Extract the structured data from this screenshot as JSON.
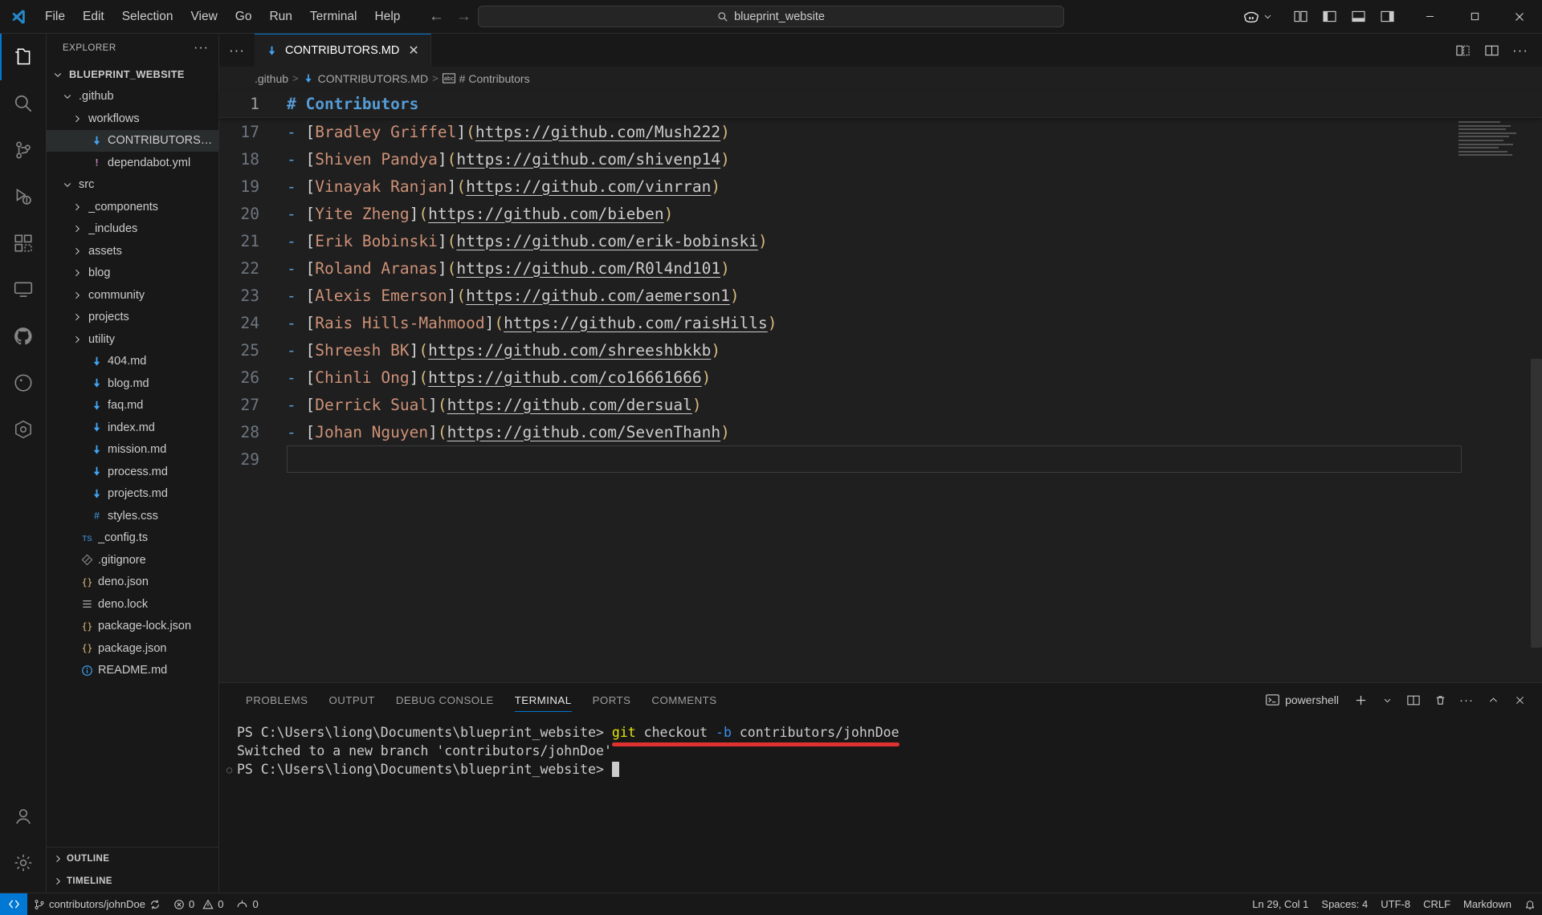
{
  "titlebar": {
    "menus": [
      "File",
      "Edit",
      "Selection",
      "View",
      "Go",
      "Run",
      "Terminal",
      "Help"
    ],
    "back_icon": "arrow-left-icon",
    "forward_icon": "arrow-right-icon",
    "command_center": {
      "value": "blueprint_website",
      "icon": "search-icon"
    },
    "copilot_label": "copilot-icon",
    "layout_icons": [
      "customize-layout-icon",
      "toggle-primary-sidebar-icon",
      "toggle-panel-icon",
      "toggle-secondary-sidebar-icon"
    ],
    "window_controls": {
      "minimize": "─",
      "maximize": "☐",
      "close": "✕"
    }
  },
  "activitybar": {
    "items": [
      {
        "name": "explorer",
        "icon": "files-icon",
        "active": true
      },
      {
        "name": "search",
        "icon": "search-icon",
        "active": false
      },
      {
        "name": "source-control",
        "icon": "source-control-icon",
        "active": false
      },
      {
        "name": "run-and-debug",
        "icon": "debug-icon",
        "active": false
      },
      {
        "name": "extensions",
        "icon": "extensions-icon",
        "active": false
      },
      {
        "name": "remote-explorer",
        "icon": "remote-explorer-icon",
        "active": false
      },
      {
        "name": "github",
        "icon": "github-icon",
        "active": false
      },
      {
        "name": "deno",
        "icon": "deno-icon",
        "active": false
      },
      {
        "name": "kubernetes",
        "icon": "kubernetes-icon",
        "active": false
      }
    ],
    "bottom": [
      {
        "name": "accounts",
        "icon": "account-icon"
      },
      {
        "name": "manage",
        "icon": "gear-icon"
      }
    ]
  },
  "sidebar": {
    "title": "EXPLORER",
    "more_actions": "···",
    "tree": [
      {
        "label": "BLUEPRINT_WEBSITE",
        "indent": 0,
        "twisty": "down",
        "icon": "none",
        "kind": "root",
        "selected": false
      },
      {
        "label": ".github",
        "indent": 1,
        "twisty": "down",
        "icon": "none",
        "kind": "folder",
        "selected": false
      },
      {
        "label": "workflows",
        "indent": 2,
        "twisty": "right",
        "icon": "none",
        "kind": "folder",
        "selected": false
      },
      {
        "label": "CONTRIBUTORS.MD",
        "indent": 2,
        "twisty": "none",
        "icon": "markdown-icon",
        "kind": "file",
        "selected": true
      },
      {
        "label": "dependabot.yml",
        "indent": 2,
        "twisty": "none",
        "icon": "yaml-icon",
        "kind": "file",
        "selected": false
      },
      {
        "label": "src",
        "indent": 1,
        "twisty": "down",
        "icon": "none",
        "kind": "folder",
        "selected": false
      },
      {
        "label": "_components",
        "indent": 2,
        "twisty": "right",
        "icon": "none",
        "kind": "folder",
        "selected": false
      },
      {
        "label": "_includes",
        "indent": 2,
        "twisty": "right",
        "icon": "none",
        "kind": "folder",
        "selected": false
      },
      {
        "label": "assets",
        "indent": 2,
        "twisty": "right",
        "icon": "none",
        "kind": "folder",
        "selected": false
      },
      {
        "label": "blog",
        "indent": 2,
        "twisty": "right",
        "icon": "none",
        "kind": "folder",
        "selected": false
      },
      {
        "label": "community",
        "indent": 2,
        "twisty": "right",
        "icon": "none",
        "kind": "folder",
        "selected": false
      },
      {
        "label": "projects",
        "indent": 2,
        "twisty": "right",
        "icon": "none",
        "kind": "folder",
        "selected": false
      },
      {
        "label": "utility",
        "indent": 2,
        "twisty": "right",
        "icon": "none",
        "kind": "folder",
        "selected": false
      },
      {
        "label": "404.md",
        "indent": 2,
        "twisty": "none",
        "icon": "markdown-icon",
        "kind": "file",
        "selected": false
      },
      {
        "label": "blog.md",
        "indent": 2,
        "twisty": "none",
        "icon": "markdown-icon",
        "kind": "file",
        "selected": false
      },
      {
        "label": "faq.md",
        "indent": 2,
        "twisty": "none",
        "icon": "markdown-icon",
        "kind": "file",
        "selected": false
      },
      {
        "label": "index.md",
        "indent": 2,
        "twisty": "none",
        "icon": "markdown-icon",
        "kind": "file",
        "selected": false
      },
      {
        "label": "mission.md",
        "indent": 2,
        "twisty": "none",
        "icon": "markdown-icon",
        "kind": "file",
        "selected": false
      },
      {
        "label": "process.md",
        "indent": 2,
        "twisty": "none",
        "icon": "markdown-icon",
        "kind": "file",
        "selected": false
      },
      {
        "label": "projects.md",
        "indent": 2,
        "twisty": "none",
        "icon": "markdown-icon",
        "kind": "file",
        "selected": false
      },
      {
        "label": "styles.css",
        "indent": 2,
        "twisty": "none",
        "icon": "css-icon",
        "kind": "file",
        "selected": false
      },
      {
        "label": "_config.ts",
        "indent": 1,
        "twisty": "none",
        "icon": "ts-icon",
        "kind": "file",
        "selected": false
      },
      {
        "label": ".gitignore",
        "indent": 1,
        "twisty": "none",
        "icon": "git-icon",
        "kind": "file",
        "selected": false
      },
      {
        "label": "deno.json",
        "indent": 1,
        "twisty": "none",
        "icon": "json-icon",
        "kind": "file",
        "selected": false
      },
      {
        "label": "deno.lock",
        "indent": 1,
        "twisty": "none",
        "icon": "lock-icon",
        "kind": "file",
        "selected": false
      },
      {
        "label": "package-lock.json",
        "indent": 1,
        "twisty": "none",
        "icon": "json-icon",
        "kind": "file",
        "selected": false
      },
      {
        "label": "package.json",
        "indent": 1,
        "twisty": "none",
        "icon": "json-icon",
        "kind": "file",
        "selected": false
      },
      {
        "label": "README.md",
        "indent": 1,
        "twisty": "none",
        "icon": "info-icon",
        "kind": "file",
        "selected": false
      }
    ],
    "sections": [
      {
        "label": "OUTLINE",
        "twisty": "right"
      },
      {
        "label": "TIMELINE",
        "twisty": "right"
      }
    ]
  },
  "editor": {
    "tab": {
      "label": "CONTRIBUTORS.MD",
      "icon": "markdown-icon",
      "close": "✕"
    },
    "tab_actions": [
      "split-editor-right-icon",
      "open-changes-icon",
      "more-actions-icon"
    ],
    "breadcrumb": [
      {
        "label": ".github",
        "icon": "none"
      },
      {
        "label": "CONTRIBUTORS.MD",
        "icon": "markdown-icon"
      },
      {
        "label": "# Contributors",
        "icon": "symbol-string-icon"
      }
    ],
    "sticky_line": {
      "number": "1",
      "text": "# Contributors"
    },
    "lines": [
      {
        "n": "17",
        "name": "Bradley Griffel",
        "url": "https://github.com/Mush222"
      },
      {
        "n": "18",
        "name": "Shiven Pandya",
        "url": "https://github.com/shivenp14"
      },
      {
        "n": "19",
        "name": "Vinayak Ranjan",
        "url": "https://github.com/vinrran"
      },
      {
        "n": "20",
        "name": "Yite Zheng",
        "url": "https://github.com/bieben"
      },
      {
        "n": "21",
        "name": "Erik Bobinski",
        "url": "https://github.com/erik-bobinski"
      },
      {
        "n": "22",
        "name": "Roland Aranas",
        "url": "https://github.com/R0l4nd101"
      },
      {
        "n": "23",
        "name": "Alexis Emerson",
        "url": "https://github.com/aemerson1"
      },
      {
        "n": "24",
        "name": "Rais Hills-Mahmood",
        "url": "https://github.com/raisHills"
      },
      {
        "n": "25",
        "name": "Shreesh BK",
        "url": "https://github.com/shreeshbkkb"
      },
      {
        "n": "26",
        "name": "Chinli Ong",
        "url": "https://github.com/co16661666"
      },
      {
        "n": "27",
        "name": "Derrick Sual",
        "url": "https://github.com/dersual"
      },
      {
        "n": "28",
        "name": "Johan Nguyen",
        "url": "https://github.com/SevenThanh"
      }
    ],
    "empty_line_number": "29"
  },
  "panel": {
    "tabs": [
      {
        "label": "PROBLEMS",
        "active": false
      },
      {
        "label": "OUTPUT",
        "active": false
      },
      {
        "label": "DEBUG CONSOLE",
        "active": false
      },
      {
        "label": "TERMINAL",
        "active": true
      },
      {
        "label": "PORTS",
        "active": false
      },
      {
        "label": "COMMENTS",
        "active": false
      }
    ],
    "shell": {
      "label": "powershell",
      "icon": "terminal-powershell-icon"
    },
    "actions": [
      "new-terminal-icon",
      "terminal-dropdown-icon",
      "split-terminal-icon",
      "kill-terminal-icon",
      "more-actions-icon",
      "maximize-panel-icon",
      "close-panel-icon"
    ],
    "terminal": {
      "prompt1": "PS C:\\Users\\liong\\Documents\\blueprint_website> ",
      "command_cmd": "git",
      "command_rest": " checkout ",
      "command_flag": "-b",
      "command_branch": " contributors/johnDoe",
      "output": "Switched to a new branch 'contributors/johnDoe'",
      "prompt2": "PS C:\\Users\\liong\\Documents\\blueprint_website> ",
      "annotation_color": "#e03131"
    }
  },
  "statusbar": {
    "remote_icon": "remote-window-icon",
    "branch": "contributors/johnDoe",
    "sync_icon": "sync-icon",
    "errors": "0",
    "warnings": "0",
    "ports": "0",
    "right": [
      {
        "label": "Ln 29, Col 1",
        "name": "editor-position"
      },
      {
        "label": "Spaces: 4",
        "name": "indentation"
      },
      {
        "label": "UTF-8",
        "name": "encoding"
      },
      {
        "label": "CRLF",
        "name": "eol"
      },
      {
        "label": "Markdown",
        "name": "language-mode"
      }
    ],
    "bell_icon": "bell-icon"
  }
}
